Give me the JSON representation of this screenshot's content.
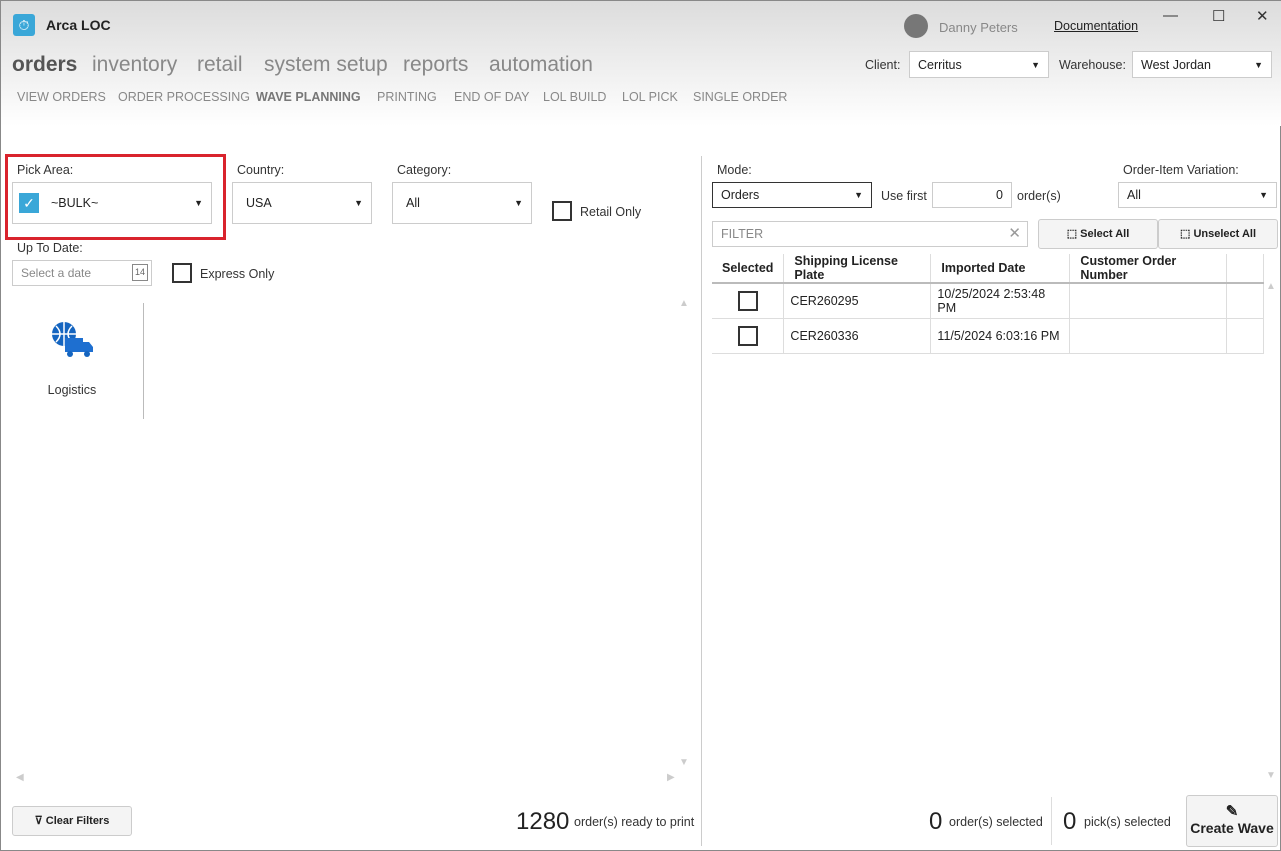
{
  "app": {
    "title": "Arca LOC",
    "user": "Danny Peters",
    "documentation": "Documentation"
  },
  "nav": {
    "items": [
      "orders",
      "inventory",
      "retail",
      "system setup",
      "reports",
      "automation"
    ],
    "active": "orders"
  },
  "subnav": {
    "items": [
      "VIEW ORDERS",
      "ORDER PROCESSING",
      "WAVE PLANNING",
      "PRINTING",
      "END OF DAY",
      "LOL BUILD",
      "LOL PICK",
      "SINGLE ORDER"
    ],
    "active": "WAVE PLANNING"
  },
  "header": {
    "client_label": "Client:",
    "client": "Cerritus",
    "warehouse_label": "Warehouse:",
    "warehouse": "West Jordan"
  },
  "filters": {
    "pick_area_label": "Pick Area:",
    "pick_area": "~BULK~",
    "pick_area_checked": true,
    "country_label": "Country:",
    "country": "USA",
    "category_label": "Category:",
    "category": "All",
    "retail_only": "Retail Only",
    "up_to_date_label": "Up To Date:",
    "date_placeholder": "Select a date",
    "calendar_day": "14",
    "express_only": "Express Only",
    "highlight_color": "#d9232d"
  },
  "tiles": [
    {
      "label": "Logistics",
      "icon": "globe-truck-icon"
    }
  ],
  "left_footer": {
    "clear_filters": "Clear Filters",
    "ready_count": "1280",
    "ready_label": "order(s) ready to print"
  },
  "right": {
    "mode_label": "Mode:",
    "mode": "Orders",
    "use_first": "Use first",
    "use_first_value": "0",
    "orders_unit": "order(s)",
    "variation_label": "Order-Item Variation:",
    "variation": "All",
    "filter_placeholder": "FILTER",
    "select_all": "Select All",
    "unselect_all": "Unselect All",
    "columns": [
      "Selected",
      "Shipping License Plate",
      "Imported Date",
      "Customer Order Number"
    ],
    "rows": [
      {
        "selected": false,
        "plate": "CER260295",
        "date": "10/25/2024 2:53:48 PM",
        "customer": ""
      },
      {
        "selected": false,
        "plate": "CER260336",
        "date": "11/5/2024 6:03:16 PM",
        "customer": ""
      }
    ]
  },
  "right_footer": {
    "orders_selected": "0",
    "orders_selected_label": "order(s) selected",
    "picks_selected": "0",
    "picks_selected_label": "pick(s) selected",
    "create_wave": "Create Wave"
  }
}
